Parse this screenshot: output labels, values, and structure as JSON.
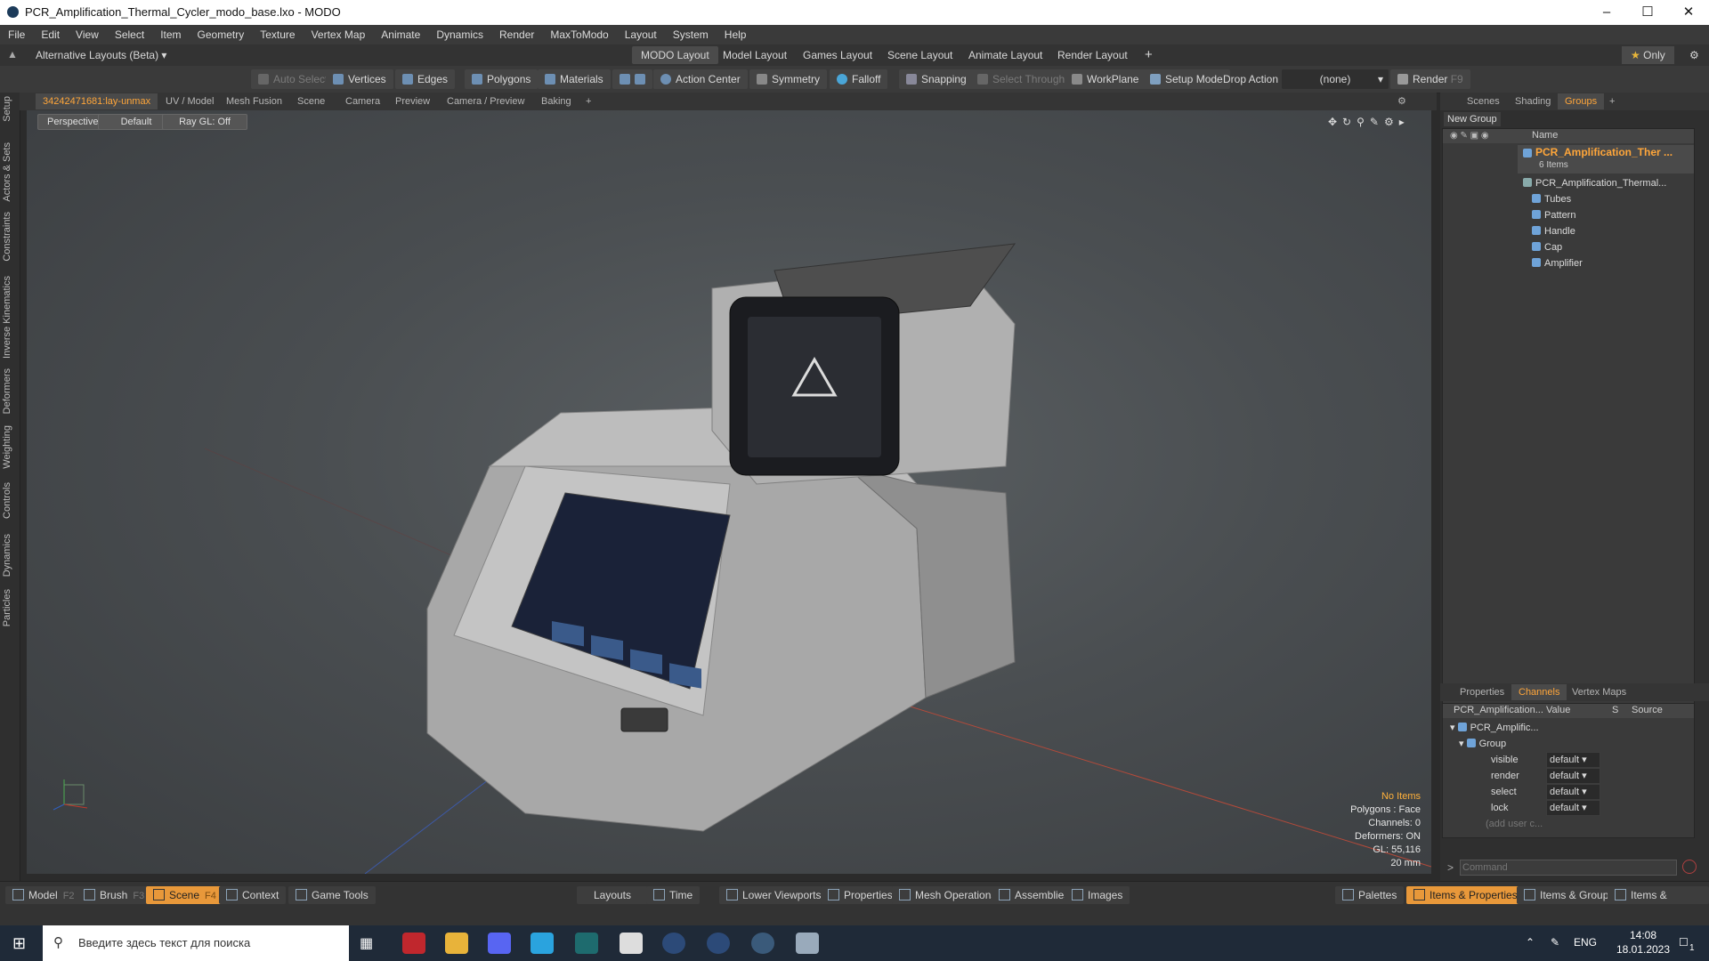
{
  "window": {
    "title": "PCR_Amplification_Thermal_Cycler_modo_base.lxo - MODO"
  },
  "menu": [
    "File",
    "Edit",
    "View",
    "Select",
    "Item",
    "Geometry",
    "Texture",
    "Vertex Map",
    "Animate",
    "Dynamics",
    "Render",
    "MaxToModo",
    "Layout",
    "System",
    "Help"
  ],
  "layouts": {
    "selector": "Alternative Layouts (Beta)",
    "tabs": [
      "MODO Layout",
      "Model Layout",
      "Games Layout",
      "Scene Layout",
      "Animate Layout",
      "Render Layout"
    ],
    "active_tab": "MODO Layout",
    "only_label": "Only"
  },
  "toolbar": {
    "auto_select": "Auto Select",
    "vertices": "Vertices",
    "edges": "Edges",
    "polygons": "Polygons",
    "materials": "Materials",
    "action_center": "Action Center",
    "symmetry": "Symmetry",
    "falloff": "Falloff",
    "snapping": "Snapping",
    "select_through": "Select Through",
    "workplane": "WorkPlane",
    "setup_mode": "Setup Mode",
    "drop_action": "Drop Action",
    "drop_value": "(none)",
    "render": "Render",
    "render_key": "F9"
  },
  "left_tabs": [
    "Setup",
    "Actors & Sets",
    "Constraints",
    "Inverse Kinematics",
    "Deformers",
    "Weighting",
    "Controls",
    "Dynamics",
    "Particles"
  ],
  "viewport_tabs": [
    "34242471681:lay-unmax",
    "UV / Model",
    "Mesh Fusion",
    "Scene",
    "Camera",
    "Preview",
    "Camera / Preview",
    "Baking"
  ],
  "viewport": {
    "view": "Perspective",
    "shading": "Default",
    "raygl": "Ray GL: Off",
    "info": {
      "items": "No Items",
      "polygons": "Polygons : Face",
      "channels": "Channels: 0",
      "deformers": "Deformers: ON",
      "gl": "GL: 55,116",
      "scale": "20 mm"
    }
  },
  "groups_panel": {
    "tabs": [
      "Scenes",
      "Shading",
      "Groups"
    ],
    "active": "Groups",
    "new_group": "New Group",
    "col_name": "Name",
    "root": "PCR_Amplification_Ther ...",
    "root_count": "6 Items",
    "children": [
      "PCR_Amplification_Thermal...",
      "Tubes",
      "Pattern",
      "Handle",
      "Cap",
      "Amplifier"
    ]
  },
  "channels_panel": {
    "tabs": [
      "Properties",
      "Channels",
      "Vertex Maps"
    ],
    "active": "Channels",
    "cols": {
      "name": "PCR_Amplification...",
      "value": "Value",
      "s": "S",
      "source": "Source"
    },
    "item": "PCR_Amplific...",
    "group": "Group",
    "rows": [
      {
        "name": "visible",
        "value": "default"
      },
      {
        "name": "render",
        "value": "default"
      },
      {
        "name": "select",
        "value": "default"
      },
      {
        "name": "lock",
        "value": "default"
      }
    ],
    "add_user": "(add user c...",
    "command_placeholder": "Command"
  },
  "bottom": {
    "model": "Model",
    "model_key": "F2",
    "brush": "Brush",
    "brush_key": "F3",
    "scene": "Scene",
    "scene_key": "F4",
    "context": "Context",
    "game_tools": "Game Tools",
    "layouts": "Layouts",
    "time": "Time",
    "lower_viewports": "Lower Viewports",
    "properties": "Properties",
    "mesh_operations": "Mesh Operations",
    "assemblies": "Assemblies",
    "images": "Images",
    "palettes": "Palettes",
    "items_properties": "Items & Properties",
    "items_groups": "Items & Groups",
    "items_shading": "Items & Shading"
  },
  "taskbar": {
    "search_placeholder": "Введите здесь текст для поиска",
    "lang": "ENG",
    "time": "14:08",
    "date": "18.01.2023",
    "notif": "1"
  },
  "colors": {
    "accent": "#e8983a",
    "selected_text": "#ffa63a"
  }
}
